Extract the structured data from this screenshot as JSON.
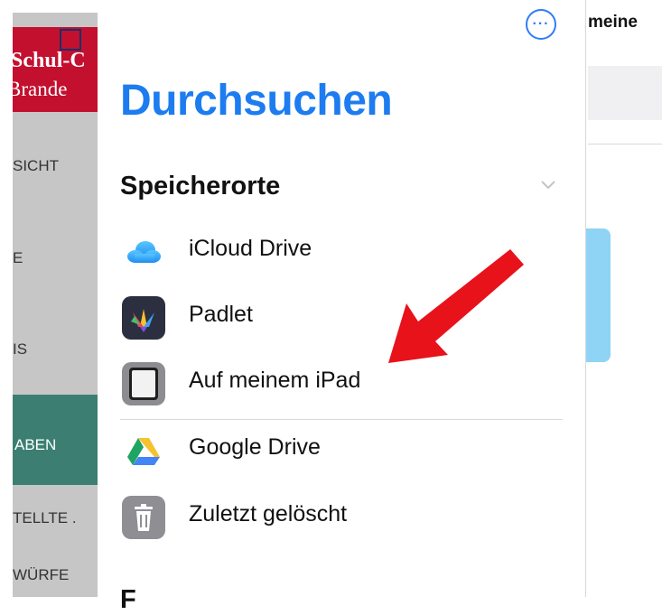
{
  "left_app": {
    "logo_line1": "Schul-C",
    "logo_line2": "Brande",
    "items": [
      {
        "label": "SICHT"
      },
      {
        "label": "E"
      },
      {
        "label": "IS"
      },
      {
        "label": "ABEN"
      },
      {
        "label": "TELLTE ."
      },
      {
        "label": "WÜRFE"
      }
    ]
  },
  "right_app": {
    "title": "meine"
  },
  "sidebar": {
    "more_icon": "ellipsis-circle-icon",
    "title": "Durchsuchen",
    "section_title": "Speicherorte",
    "locations": [
      {
        "label": "iCloud Drive",
        "icon": "icloud-icon"
      },
      {
        "label": "Padlet",
        "icon": "padlet-icon"
      },
      {
        "label": "Auf meinem iPad",
        "icon": "ipad-icon"
      },
      {
        "label": "Google Drive",
        "icon": "google-drive-icon"
      },
      {
        "label": "Zuletzt gelöscht",
        "icon": "trash-icon"
      }
    ],
    "next_section_peek": "F"
  },
  "colors": {
    "accent": "#1c7cf0",
    "arrow": "#e8121b",
    "logo_red": "#c3102f",
    "left_active": "#3c7f72"
  }
}
